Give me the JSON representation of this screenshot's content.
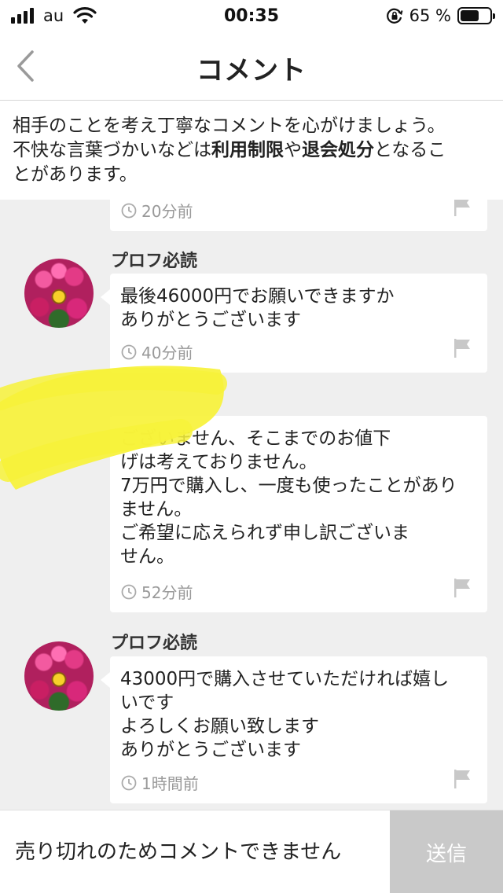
{
  "status_bar": {
    "carrier": "au",
    "time": "00:35",
    "battery_percent": "65 %",
    "battery_level": 0.65
  },
  "nav": {
    "title": "コメント"
  },
  "notice": {
    "line1": "相手のことを考え丁寧なコメントを心がけましょう。",
    "line2_prefix": "不快な言葉づかいなどは",
    "line2_bold1": "利用制限",
    "line2_mid": "や",
    "line2_bold2": "退会処分",
    "line2_suffix": "となるこ",
    "line3": "とがあります。"
  },
  "comments": [
    {
      "time_ago": "20分前"
    },
    {
      "username": "プロフ必読",
      "message": "最後46000円でお願いできますか\nありがとうございます",
      "time_ago": "40分前"
    },
    {
      "message": "ございません、そこまでのお値下\nげは考えておりません。\n7万円で購入し、一度も使ったことがあり\nません。\nご希望に応えられず申し訳ございま\nせん。",
      "time_ago": "52分前"
    },
    {
      "username": "プロフ必読",
      "message": "43000円で購入させていただければ嬉し\nいです\nよろしくお願い致します\nありがとうございます",
      "time_ago": "1時間前"
    }
  ],
  "bottom_bar": {
    "input_placeholder": "売り切れのためコメントできません",
    "send_label": "送信"
  },
  "colors": {
    "list_background": "#efefef",
    "send_disabled": "#c9c9c9",
    "highlight": "#f7f23a"
  },
  "icons": {
    "back": "chevron-left-icon",
    "clock": "clock-icon",
    "flag": "flag-icon"
  }
}
